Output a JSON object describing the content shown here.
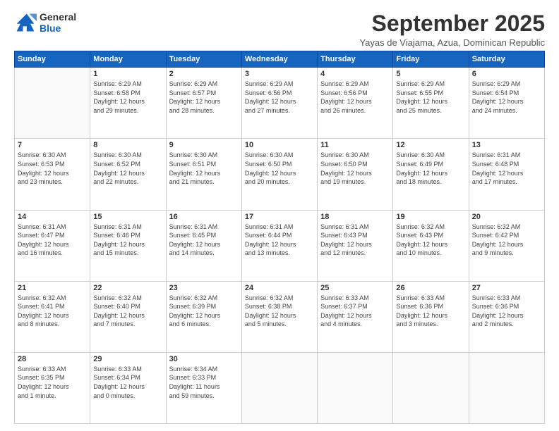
{
  "logo": {
    "line1": "General",
    "line2": "Blue"
  },
  "title": "September 2025",
  "subtitle": "Yayas de Viajama, Azua, Dominican Republic",
  "days_header": [
    "Sunday",
    "Monday",
    "Tuesday",
    "Wednesday",
    "Thursday",
    "Friday",
    "Saturday"
  ],
  "weeks": [
    [
      {
        "num": "",
        "detail": ""
      },
      {
        "num": "1",
        "detail": "Sunrise: 6:29 AM\nSunset: 6:58 PM\nDaylight: 12 hours\nand 29 minutes."
      },
      {
        "num": "2",
        "detail": "Sunrise: 6:29 AM\nSunset: 6:57 PM\nDaylight: 12 hours\nand 28 minutes."
      },
      {
        "num": "3",
        "detail": "Sunrise: 6:29 AM\nSunset: 6:56 PM\nDaylight: 12 hours\nand 27 minutes."
      },
      {
        "num": "4",
        "detail": "Sunrise: 6:29 AM\nSunset: 6:56 PM\nDaylight: 12 hours\nand 26 minutes."
      },
      {
        "num": "5",
        "detail": "Sunrise: 6:29 AM\nSunset: 6:55 PM\nDaylight: 12 hours\nand 25 minutes."
      },
      {
        "num": "6",
        "detail": "Sunrise: 6:29 AM\nSunset: 6:54 PM\nDaylight: 12 hours\nand 24 minutes."
      }
    ],
    [
      {
        "num": "7",
        "detail": "Sunrise: 6:30 AM\nSunset: 6:53 PM\nDaylight: 12 hours\nand 23 minutes."
      },
      {
        "num": "8",
        "detail": "Sunrise: 6:30 AM\nSunset: 6:52 PM\nDaylight: 12 hours\nand 22 minutes."
      },
      {
        "num": "9",
        "detail": "Sunrise: 6:30 AM\nSunset: 6:51 PM\nDaylight: 12 hours\nand 21 minutes."
      },
      {
        "num": "10",
        "detail": "Sunrise: 6:30 AM\nSunset: 6:50 PM\nDaylight: 12 hours\nand 20 minutes."
      },
      {
        "num": "11",
        "detail": "Sunrise: 6:30 AM\nSunset: 6:50 PM\nDaylight: 12 hours\nand 19 minutes."
      },
      {
        "num": "12",
        "detail": "Sunrise: 6:30 AM\nSunset: 6:49 PM\nDaylight: 12 hours\nand 18 minutes."
      },
      {
        "num": "13",
        "detail": "Sunrise: 6:31 AM\nSunset: 6:48 PM\nDaylight: 12 hours\nand 17 minutes."
      }
    ],
    [
      {
        "num": "14",
        "detail": "Sunrise: 6:31 AM\nSunset: 6:47 PM\nDaylight: 12 hours\nand 16 minutes."
      },
      {
        "num": "15",
        "detail": "Sunrise: 6:31 AM\nSunset: 6:46 PM\nDaylight: 12 hours\nand 15 minutes."
      },
      {
        "num": "16",
        "detail": "Sunrise: 6:31 AM\nSunset: 6:45 PM\nDaylight: 12 hours\nand 14 minutes."
      },
      {
        "num": "17",
        "detail": "Sunrise: 6:31 AM\nSunset: 6:44 PM\nDaylight: 12 hours\nand 13 minutes."
      },
      {
        "num": "18",
        "detail": "Sunrise: 6:31 AM\nSunset: 6:43 PM\nDaylight: 12 hours\nand 12 minutes."
      },
      {
        "num": "19",
        "detail": "Sunrise: 6:32 AM\nSunset: 6:43 PM\nDaylight: 12 hours\nand 10 minutes."
      },
      {
        "num": "20",
        "detail": "Sunrise: 6:32 AM\nSunset: 6:42 PM\nDaylight: 12 hours\nand 9 minutes."
      }
    ],
    [
      {
        "num": "21",
        "detail": "Sunrise: 6:32 AM\nSunset: 6:41 PM\nDaylight: 12 hours\nand 8 minutes."
      },
      {
        "num": "22",
        "detail": "Sunrise: 6:32 AM\nSunset: 6:40 PM\nDaylight: 12 hours\nand 7 minutes."
      },
      {
        "num": "23",
        "detail": "Sunrise: 6:32 AM\nSunset: 6:39 PM\nDaylight: 12 hours\nand 6 minutes."
      },
      {
        "num": "24",
        "detail": "Sunrise: 6:32 AM\nSunset: 6:38 PM\nDaylight: 12 hours\nand 5 minutes."
      },
      {
        "num": "25",
        "detail": "Sunrise: 6:33 AM\nSunset: 6:37 PM\nDaylight: 12 hours\nand 4 minutes."
      },
      {
        "num": "26",
        "detail": "Sunrise: 6:33 AM\nSunset: 6:36 PM\nDaylight: 12 hours\nand 3 minutes."
      },
      {
        "num": "27",
        "detail": "Sunrise: 6:33 AM\nSunset: 6:36 PM\nDaylight: 12 hours\nand 2 minutes."
      }
    ],
    [
      {
        "num": "28",
        "detail": "Sunrise: 6:33 AM\nSunset: 6:35 PM\nDaylight: 12 hours\nand 1 minute."
      },
      {
        "num": "29",
        "detail": "Sunrise: 6:33 AM\nSunset: 6:34 PM\nDaylight: 12 hours\nand 0 minutes."
      },
      {
        "num": "30",
        "detail": "Sunrise: 6:34 AM\nSunset: 6:33 PM\nDaylight: 11 hours\nand 59 minutes."
      },
      {
        "num": "",
        "detail": ""
      },
      {
        "num": "",
        "detail": ""
      },
      {
        "num": "",
        "detail": ""
      },
      {
        "num": "",
        "detail": ""
      }
    ]
  ]
}
